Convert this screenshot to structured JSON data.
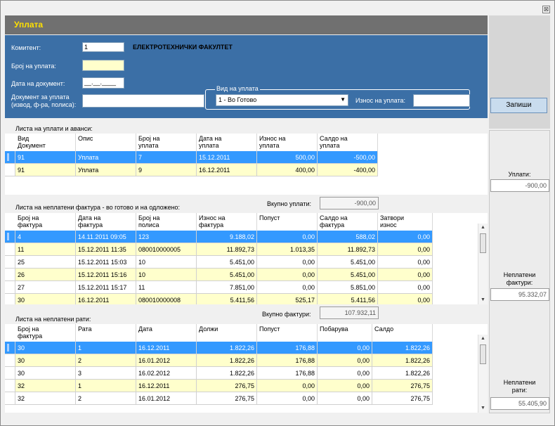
{
  "window": {
    "title": "Уплата",
    "close_glyph": "⊠"
  },
  "form": {
    "komitent_label": "Комитент:",
    "komitent_value": "1",
    "komitent_name": "ЕЛЕКТРОТЕХНИЧКИ ФАКУЛТЕТ",
    "broj_label": "Број на уплата:",
    "broj_value": "",
    "datum_label": "Дата на документ:",
    "datum_value": "__.__.____",
    "dokument_label_1": "Документ за уплата",
    "dokument_label_2": "(извод, ф-ра, полиса):",
    "dokument_value": "",
    "vid_legend": "Вид на уплата",
    "vid_value": "1 - Во Готово",
    "iznos_label": "Износ на уплата:",
    "iznos_value": ""
  },
  "save_button": "Запиши",
  "payments": {
    "title": "Листа на уплати и аванси:",
    "columns": [
      "Вид\nДокумент",
      "Опис",
      "Број на\nуплата",
      "Дата на\nуплата",
      "Износ на\nуплата",
      "Салдо на\nуплата"
    ],
    "rows": [
      [
        "91",
        "Уплата",
        "7",
        "15.12.2011",
        "500,00",
        "-500,00"
      ],
      [
        "91",
        "Уплата",
        "9",
        "16.12.2011",
        "400,00",
        "-400,00"
      ]
    ],
    "total_label": "Вкупно уплати:",
    "total_value": "-900,00"
  },
  "invoices": {
    "title": "Листа на неплатени фактура - во готово и на одложено:",
    "columns": [
      "Број на\nфактура",
      "Дата на\nфактура",
      "Број на\nполиса",
      "Износ на\nфактура",
      "Попуст",
      "Салдо на\nфактура",
      "Затвори\nизнос"
    ],
    "rows": [
      [
        "4",
        "14.11.2011 09:05",
        "123",
        "9.188,02",
        "0,00",
        "588,02",
        "0,00"
      ],
      [
        "11",
        "15.12.2011 11:35",
        "080010000005",
        "11.892,73",
        "1.013,35",
        "11.892,73",
        "0,00"
      ],
      [
        "25",
        "15.12.2011 15:03",
        "10",
        "5.451,00",
        "0,00",
        "5.451,00",
        "0,00"
      ],
      [
        "26",
        "15.12.2011 15:16",
        "10",
        "5.451,00",
        "0,00",
        "5.451,00",
        "0,00"
      ],
      [
        "27",
        "15.12.2011 15:17",
        "11",
        "7.851,00",
        "0,00",
        "5.851,00",
        "0,00"
      ],
      [
        "30",
        "16.12.2011",
        "080010000008",
        "5.411,56",
        "525,17",
        "5.411,56",
        "0,00"
      ]
    ],
    "total_label": "Вкупно фактури:",
    "total_value": "107.932,11"
  },
  "installments": {
    "title": "Листа на неплатени рати:",
    "columns": [
      "Број на\nфактура",
      "Рата",
      "Дата",
      "Должи",
      "Попуст",
      "Побарува",
      "Салдо"
    ],
    "rows": [
      [
        "30",
        "1",
        "16.12.2011",
        "1.822,26",
        "176,88",
        "0,00",
        "1.822,26"
      ],
      [
        "30",
        "2",
        "16.01.2012",
        "1.822,26",
        "176,88",
        "0,00",
        "1.822,26"
      ],
      [
        "30",
        "3",
        "16.02.2012",
        "1.822,26",
        "176,88",
        "0,00",
        "1.822,26"
      ],
      [
        "32",
        "1",
        "16.12.2011",
        "276,75",
        "0,00",
        "0,00",
        "276,75"
      ],
      [
        "32",
        "2",
        "16.01.2012",
        "276,75",
        "0,00",
        "0,00",
        "276,75"
      ]
    ]
  },
  "side": {
    "uplati_label": "Уплати:",
    "uplati_value": "-900,00",
    "fakturi_label_1": "Неплатени",
    "fakturi_label_2": "фактури:",
    "fakturi_value": "95.332,07",
    "rati_label_1": "Неплатени",
    "rati_label_2": "рати:",
    "rati_value": "55.405,90"
  },
  "colors": {
    "header_title": "#ffe000",
    "form_panel": "#3b6fa6",
    "selected_row": "#3399ff",
    "alt_row": "#ffffcc"
  },
  "icons": [
    "close-icon",
    "dropdown-arrow-icon",
    "scroll-up-icon",
    "scroll-down-icon"
  ]
}
